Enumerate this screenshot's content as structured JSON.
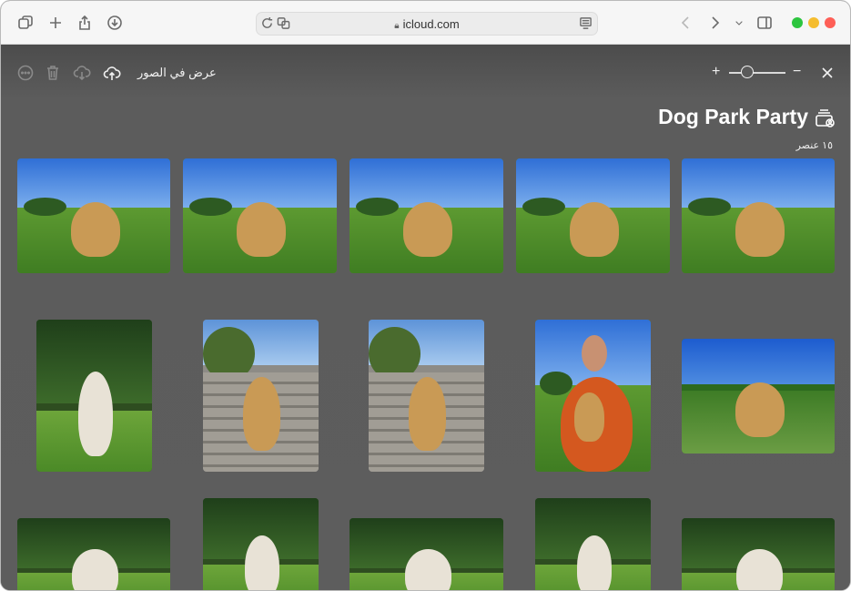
{
  "browser": {
    "url": "icloud.com",
    "traffic_colors": {
      "green": "#2dc53f",
      "yellow": "#f5bd2f",
      "red": "#fe5f57"
    },
    "icons": [
      "tab-overview-icon",
      "new-tab-icon",
      "share-icon",
      "download-icon",
      "reload-icon",
      "translate-icon",
      "reader-icon",
      "back-icon",
      "forward-icon",
      "chevron-down-icon",
      "sidebar-icon"
    ]
  },
  "photos_toolbar": {
    "view_in_photos": "عرض في الصور",
    "zoom_in": "+",
    "zoom_out": "−",
    "icons": [
      "more-icon",
      "trash-icon",
      "cloud-download-icon",
      "cloud-upload-icon",
      "close-icon",
      "shared-album-icon"
    ]
  },
  "album": {
    "title": "Dog Park Party",
    "item_count": "١٥ عنصر"
  },
  "colors": {
    "background": "#5d5d5d",
    "sky": "#2f6fd6",
    "grass": "#4e8f2b",
    "dog_golden": "#c99a55",
    "dog_white": "#e8e2d6",
    "shirt_orange": "#d4581f"
  },
  "photos": [
    {
      "name": "photo-dog-lying-grass",
      "scene": "sky-grass",
      "subject": "golden"
    },
    {
      "name": "photo-dog-sitting-tongue",
      "scene": "sky-grass",
      "subject": "golden"
    },
    {
      "name": "photo-dog-lying-smiling",
      "scene": "sky-grass",
      "subject": "golden"
    },
    {
      "name": "photo-dog-catching-frisbee",
      "scene": "sky-grass",
      "subject": "golden"
    },
    {
      "name": "photo-dog-jumping-frisbee",
      "scene": "sky-grass",
      "subject": "golden"
    },
    {
      "name": "photo-white-dog-field",
      "scene": "forest",
      "subject": "white"
    },
    {
      "name": "photo-dog-on-steps-1",
      "scene": "steps",
      "subject": "golden"
    },
    {
      "name": "photo-dog-on-steps-2",
      "scene": "steps",
      "subject": "golden"
    },
    {
      "name": "photo-woman-holding-puppy",
      "scene": "sky-grass",
      "subject": "person"
    },
    {
      "name": "photo-dog-in-flowers",
      "scene": "palms",
      "subject": "golden"
    },
    {
      "name": "photo-white-dog-lying",
      "scene": "forest",
      "subject": "white"
    },
    {
      "name": "photo-white-dog-standing",
      "scene": "forest",
      "subject": "white"
    },
    {
      "name": "photo-white-dog-lawn",
      "scene": "forest",
      "subject": "white"
    },
    {
      "name": "photo-white-dog-portrait",
      "scene": "forest",
      "subject": "white"
    },
    {
      "name": "photo-white-dog-shade",
      "scene": "forest",
      "subject": "white"
    }
  ]
}
